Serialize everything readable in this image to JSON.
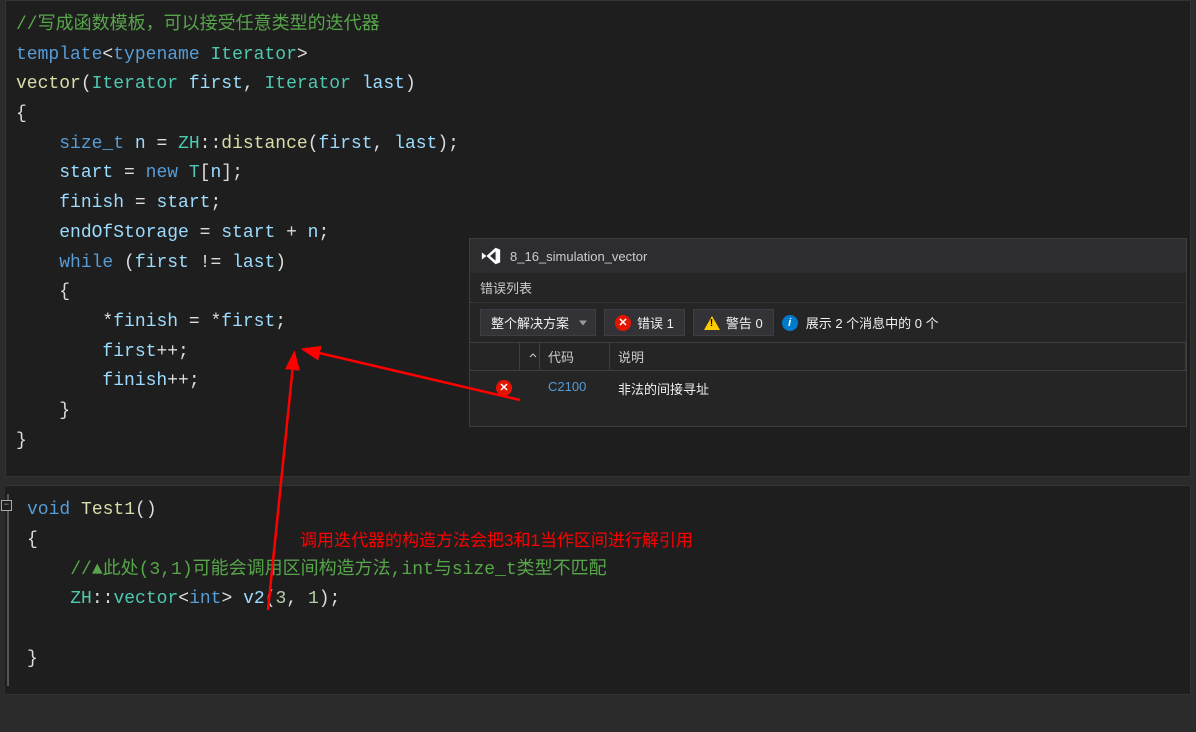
{
  "code1": {
    "l1": "//写成函数模板，可以接受任意类型的迭代器",
    "l2_template": "template",
    "l2_typename": "typename",
    "l2_iterator": "Iterator",
    "l3_vector": "vector",
    "l3_iterator1": "Iterator",
    "l3_first": "first",
    "l3_iterator2": "Iterator",
    "l3_last": "last",
    "l5_sizet": "size_t",
    "l5_n": "n",
    "l5_zh": "ZH",
    "l5_distance": "distance",
    "l5_first": "first",
    "l5_last": "last",
    "l6_start": "start",
    "l6_new": "new",
    "l6_T": "T",
    "l6_n": "n",
    "l7_finish": "finish",
    "l7_start": "start",
    "l8_eos": "endOfStorage",
    "l8_start": "start",
    "l8_n": "n",
    "l9_while": "while",
    "l9_first": "first",
    "l9_last": "last",
    "l11_finish": "finish",
    "l11_first": "first",
    "l12_first": "first",
    "l13_finish": "finish"
  },
  "code2": {
    "l1_void": "void",
    "l1_test1": "Test1",
    "l3_comment": "//▲此处(3,1)可能会调用区间构造方法,int与size_t类型不匹配",
    "l4_zh": "ZH",
    "l4_vector": "vector",
    "l4_int": "int",
    "l4_v2": "v2",
    "l4_num1": "3",
    "l4_num2": "1"
  },
  "annotation": "调用迭代器的构造方法会把3和1当作区间进行解引用",
  "errorPanel": {
    "title": "8_16_simulation_vector",
    "subtitle": "错误列表",
    "dropdown": "整个解决方案",
    "errorBtn": "错误 1",
    "warnBtn": "警告 0",
    "infoText": "展示 2 个消息中的 0 个",
    "headerCode": "代码",
    "headerDesc": "说明",
    "rowCode": "C2100",
    "rowDesc": "非法的间接寻址"
  }
}
